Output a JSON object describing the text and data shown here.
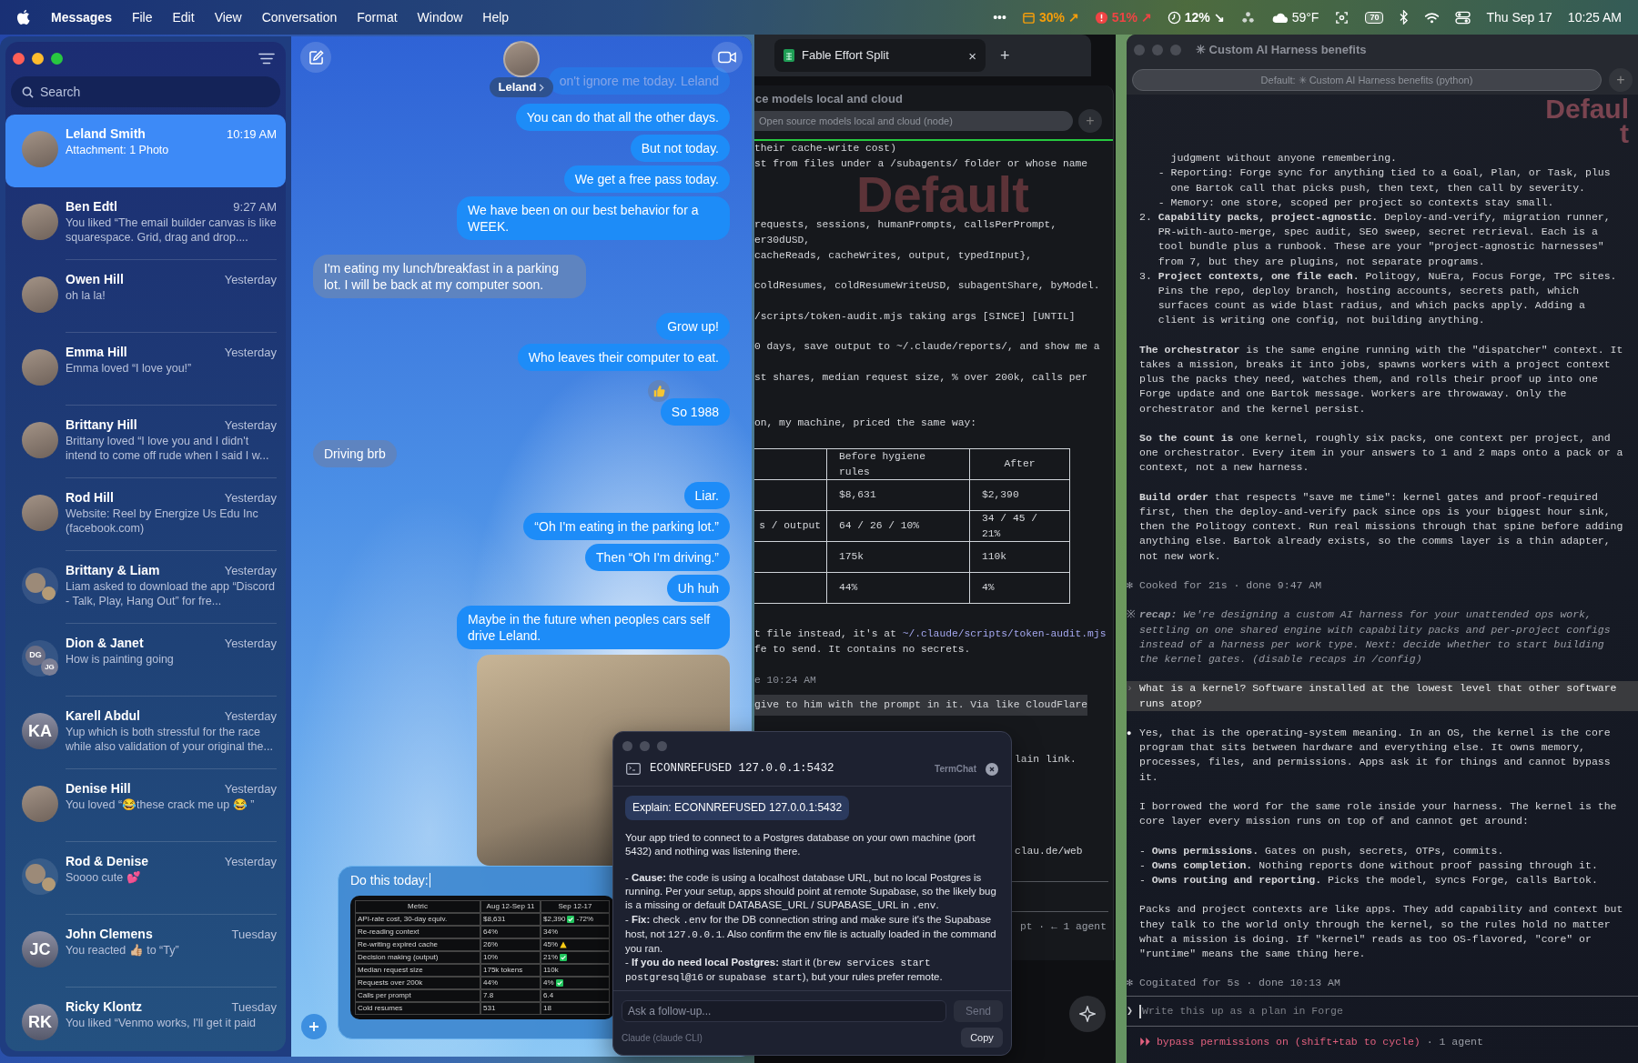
{
  "menubar": {
    "app_name": "Messages",
    "menus": [
      "File",
      "Edit",
      "View",
      "Conversation",
      "Format",
      "Window",
      "Help"
    ],
    "status_items": [
      {
        "kind": "overflow",
        "text": "•••"
      },
      {
        "kind": "calendar",
        "text": "30% ↗",
        "color": "#f59e0b"
      },
      {
        "kind": "alert",
        "text": "51% ↗",
        "color": "#ef4444"
      },
      {
        "kind": "clock",
        "text": "12% ↘",
        "color": "#ffffff"
      },
      {
        "kind": "recycle"
      },
      {
        "kind": "cloud",
        "text": "59°F"
      },
      {
        "kind": "screen"
      },
      {
        "kind": "battery",
        "text": "70"
      },
      {
        "kind": "bluetooth"
      },
      {
        "kind": "wifi"
      },
      {
        "kind": "toggles"
      },
      {
        "kind": "text",
        "text": "Thu Sep 17"
      },
      {
        "kind": "text",
        "text": "10:25 AM"
      }
    ]
  },
  "messages": {
    "search_placeholder": "Search",
    "conversations": [
      {
        "name": "Leland Smith",
        "time": "10:19 AM",
        "preview": "Attachment: 1 Photo",
        "selected": true,
        "avatar": {
          "kind": "photo"
        }
      },
      {
        "name": "Ben Edtl",
        "time": "9:27 AM",
        "preview": "You liked “The email builder canvas is like squarespace. Grid, drag and drop....",
        "selected": false,
        "avatar": {
          "kind": "photo"
        }
      },
      {
        "name": "Owen Hill",
        "time": "Yesterday",
        "preview": "oh la la!",
        "selected": false,
        "avatar": {
          "kind": "photo"
        }
      },
      {
        "name": "Emma Hill",
        "time": "Yesterday",
        "preview": "Emma loved “I love you!”",
        "selected": false,
        "avatar": {
          "kind": "photo"
        }
      },
      {
        "name": "Brittany Hill",
        "time": "Yesterday",
        "preview": "Brittany loved “I love you and I didn't intend to come off rude when I said I w...",
        "selected": false,
        "avatar": {
          "kind": "photo"
        }
      },
      {
        "name": "Rod Hill",
        "time": "Yesterday",
        "preview": "Website: Reel by Energize Us Edu Inc (facebook.com)",
        "selected": false,
        "avatar": {
          "kind": "photo"
        }
      },
      {
        "name": "Brittany & Liam",
        "time": "Yesterday",
        "preview": "Liam asked to download the app “Discord - Talk, Play, Hang Out” for fre...",
        "selected": false,
        "avatar": {
          "kind": "group_photo"
        }
      },
      {
        "name": "Dion & Janet",
        "time": "Yesterday",
        "preview": "How is painting going",
        "selected": false,
        "avatar": {
          "kind": "group_initials",
          "initials": [
            "DG",
            "JG"
          ]
        }
      },
      {
        "name": "Karell Abdul",
        "time": "Yesterday",
        "preview": "Yup which is both stressful for the race while also validation of your original the...",
        "selected": false,
        "avatar": {
          "kind": "initials",
          "initials": "KA"
        }
      },
      {
        "name": "Denise Hill",
        "time": "Yesterday",
        "preview": "You loved “😂these crack me up 😂 ”",
        "selected": false,
        "avatar": {
          "kind": "photo"
        }
      },
      {
        "name": "Rod & Denise",
        "time": "Yesterday",
        "preview": "Soooo cute 💕",
        "selected": false,
        "avatar": {
          "kind": "group_photo"
        }
      },
      {
        "name": "John Clemens",
        "time": "Tuesday",
        "preview": "You reacted 👍🏼 to “Ty”",
        "selected": false,
        "avatar": {
          "kind": "initials",
          "initials": "JC"
        }
      },
      {
        "name": "Ricky Klontz",
        "time": "Tuesday",
        "preview": "You liked “Venmo works, I'll get it paid",
        "selected": false,
        "avatar": {
          "kind": "initials",
          "initials": "RK"
        }
      }
    ]
  },
  "chat": {
    "contact": "Leland",
    "messages": [
      {
        "kind": "sent",
        "text": "on't ignore me today. Leland",
        "faded": true
      },
      {
        "kind": "sent",
        "text": "You can do that all the other days.",
        "faded": false
      },
      {
        "kind": "sent",
        "text": "But not today.",
        "faded": false
      },
      {
        "kind": "sent",
        "text": "We get a free pass today.",
        "faded": false
      },
      {
        "kind": "sent",
        "text": "We have been on our best behavior for a WEEK.",
        "faded": false
      },
      {
        "kind": "received",
        "text": "I'm eating my lunch/breakfast in a parking lot. I will be back at my computer soon.",
        "faded": false
      },
      {
        "kind": "sent",
        "text": "Grow up!",
        "faded": false
      },
      {
        "kind": "sent",
        "text": "Who leaves their computer to eat.",
        "faded": false
      },
      {
        "kind": "tapped",
        "text": "So 1988",
        "faded": false
      },
      {
        "kind": "received",
        "text": "Driving brb",
        "faded": false
      },
      {
        "kind": "sent",
        "text": "Liar.",
        "faded": false
      },
      {
        "kind": "sent",
        "text": "“Oh I'm eating in the parking lot.”",
        "faded": false
      },
      {
        "kind": "sent",
        "text": "Then “Oh I'm driving.”",
        "faded": false
      },
      {
        "kind": "sent",
        "text": "Uh huh",
        "faded": false
      },
      {
        "kind": "sent",
        "text": "Maybe in the future when peoples cars self drive Leland.",
        "faded": false
      },
      {
        "kind": "photo"
      }
    ],
    "composer": {
      "text": "Do this today:",
      "attachment": {
        "columns": [
          "Metric",
          "Aug 12-Sep 11",
          "Sep 12-17"
        ],
        "rows": [
          {
            "kind": "good",
            "cells": [
              "API-rate cost, 30-day equiv.",
              "$8,631",
              "$2,390"
            ],
            "note": "-72%"
          },
          {
            "kind": "plain",
            "cells": [
              "Re-reading context",
              "64%",
              "34%"
            ]
          },
          {
            "kind": "warning",
            "cells": [
              "Re-writing expired cache",
              "26%",
              "45%"
            ]
          },
          {
            "kind": "good",
            "cells": [
              "Decision making (output)",
              "10%",
              "21%"
            ]
          },
          {
            "kind": "plain",
            "cells": [
              "Median request size",
              "175k tokens",
              "110k"
            ]
          },
          {
            "kind": "good",
            "cells": [
              "Requests over 200k",
              "44%",
              "4%"
            ]
          },
          {
            "kind": "plain",
            "cells": [
              "Calls per prompt",
              "7.8",
              "6.4"
            ]
          },
          {
            "kind": "plain",
            "cells": [
              "Cold resumes",
              "531",
              "18"
            ]
          }
        ]
      }
    }
  },
  "middle_terminal": {
    "tab_title": "Fable Effort Split",
    "tab_close": "×",
    "new_tab": "+",
    "window_title": "ce models local and cloud",
    "session_field": "Open source models local and cloud (node)",
    "add_session": "+",
    "badge": "Default",
    "output_head": "their cache-write cost)\nst from files under a /subagents/ folder or whose name",
    "output": "requests, sessions, humanPrompts, callsPerPrompt,\ner30dUSD,\ncacheReads, cacheWrites, output, typedInput},\n\ncoldResumes, coldResumeWriteUSD, subagentShare, byModel.\n\n/scripts/token-audit.mjs taking args [SINCE] [UNTIL]\n\n0 days, save output to ~/.claude/reports/, and show me a\n\nst shares, median request size, % over 200k, calls per\n\n\non, my machine, priced the same way:",
    "table": {
      "columns": [
        "Before hygiene rules",
        "After"
      ],
      "rows": [
        {
          "before": "$8,631",
          "after": "$2,390"
        },
        {
          "column_1": "s / output",
          "before": "64 / 26 / 10%",
          "after": "34 / 45 / 21%"
        },
        {
          "before": "175k",
          "after": "110k"
        },
        {
          "before": "44%",
          "after": "4%"
        }
      ]
    },
    "link_line": {
      "text": "t file instead, it's at ",
      "link": "~/.claude/scripts/token-audit.mjs"
    },
    "after_link": "fe to send. It contains no secrets.",
    "timestamp": "e 10:24 AM",
    "highlight": "give to him with the prompt in it. Via like CloudFlare",
    "tail": "lain link.\n\n\n\n\n\nclau.de/web",
    "status": "pt · ← 1 agent"
  },
  "right_terminal": {
    "title": "✳ Custom AI Harness benefits",
    "session_field": "Default: ✳ Custom AI Harness benefits (python)",
    "add_session": "+",
    "badge": [
      "Defaul",
      "t"
    ],
    "blocks": [
      {
        "kind": "text",
        "text": "     judgment without anyone remembering.\n   - Reporting: Forge sync for anything tied to a Goal, Plan, or Task, plus\n     one Bartok call that picks push, then text, then call by severity.\n   - Memory: one store, scoped per project so contexts stay small.\n2. **Capability packs, project-agnostic.** Deploy-and-verify, migration runner,\n   PR-with-auto-merge, spec audit, SEO sweep, secret retrieval. Each is a\n   tool bundle plus a runbook. These are your \"project-agnostic harnesses\"\n   from 7, but they are plugins, not separate programs.\n3. **Project contexts, one file each.** Politogy, NuEra, Focus Forge, TPC sites.\n   Pins the repo, deploy branch, hosting accounts, secrets path, which\n   surfaces count as wide blast radius, and which packs apply. Adding a\n   client is writing one config, not building anything."
      },
      {
        "kind": "text",
        "text": "**The orchestrator** is the same engine running with the \"dispatcher\" context. It\ntakes a mission, breaks it into jobs, spawns workers with a project context\nplus the packs they need, watches them, and rolls their proof up into one\nForge update and one Bartok message. Workers are throwaway. Only the\norchestrator and the kernel persist."
      },
      {
        "kind": "text",
        "text": "**So the count is** one kernel, roughly six packs, one context per project, and\none orchestrator. Every item in your answers to 1 and 2 maps onto a pack or a\ncontext, not a new harness."
      },
      {
        "kind": "text",
        "text": "**Build order** that respects \"save me time\": kernel gates and proof-required\nfirst, then the deploy-and-verify pack since ops is your biggest hour sink,\nthen the Politogy context. Run real missions through that spine before adding\nanything else. Bartok already exists, so the comms layer is a thin adapter,\nnot new work."
      },
      {
        "kind": "meta",
        "glyph": "✻",
        "text": "Cooked for 21s · done 9:47 AM"
      },
      {
        "kind": "recap",
        "glyph": "※",
        "text": "**recap:** We're designing a custom AI harness for your unattended ops work,\nsettling on one shared engine with capability packs and per-project configs\ninstead of a harness per work type. Next: decide whether to start building\nthe kernel gates. (disable recaps in /config)"
      },
      {
        "kind": "prompt",
        "glyph": "›",
        "text": "What is a kernel? Software installed at the lowest level that other software\nruns atop?"
      },
      {
        "kind": "answer",
        "glyph": "●",
        "text": "Yes, that is the operating-system meaning. In an OS, the kernel is the core\nprogram that sits between hardware and everything else. It owns memory,\nprocesses, files, and permissions. Apps ask it for things and cannot bypass\nit."
      },
      {
        "kind": "text",
        "text": "I borrowed the word for the same role inside your harness. The kernel is the\ncore layer every mission runs on top of and cannot get around:"
      },
      {
        "kind": "text",
        "text": "- **Owns permissions.** Gates on push, secrets, OTPs, commits.\n- **Owns completion.** Nothing reports done without proof passing through it.\n- **Owns routing and reporting.** Picks the model, syncs Forge, calls Bartok."
      },
      {
        "kind": "text",
        "text": "Packs and project contexts are like apps. They add capability and context but\nthey talk to the world only through the kernel, so the rules hold no matter\nwhat a mission is doing. If \"kernel\" reads as too OS-flavored, \"core\" or\n\"runtime\" means the same thing here."
      },
      {
        "kind": "meta",
        "glyph": "✻",
        "text": "Cogitated for 5s · done 10:13 AM"
      }
    ],
    "input": {
      "prompt": "❯",
      "placeholder": "Write this up as a plan in Forge"
    },
    "status": {
      "mode": "⏵⏵ bypass permissions on (shift+tab to cycle)",
      "agents": "· 1 agent"
    }
  },
  "termchat": {
    "title": "ECONNREFUSED 127.0.0.1:5432",
    "app": "TermChat",
    "question": "Explain: ECONNREFUSED 127.0.0.1:5432",
    "paragraphs": [
      [
        {
          "kind": "plain",
          "text": "Your app tried to connect to a Postgres database on your own machine (port 5432) and nothing was listening there."
        }
      ],
      [
        {
          "kind": "plain",
          "text": "- "
        },
        {
          "kind": "bold",
          "text": "Cause:"
        },
        {
          "kind": "plain",
          "text": " the code is using a localhost database URL, but no local Postgres is running. Per your setup, apps should point at remote Supabase, so the likely bug is a missing or default DATABASE_URL / SUPABASE_URL in "
        },
        {
          "kind": "code",
          "text": ".env"
        },
        {
          "kind": "plain",
          "text": "."
        }
      ],
      [
        {
          "kind": "plain",
          "text": "- "
        },
        {
          "kind": "bold",
          "text": "Fix:"
        },
        {
          "kind": "plain",
          "text": " check "
        },
        {
          "kind": "code",
          "text": ".env"
        },
        {
          "kind": "plain",
          "text": " for the DB connection string and make sure it's the Supabase host, not "
        },
        {
          "kind": "code",
          "text": "127.0.0.1"
        },
        {
          "kind": "plain",
          "text": ". Also confirm the env file is actually loaded in the command you ran."
        }
      ],
      [
        {
          "kind": "plain",
          "text": "- "
        },
        {
          "kind": "bold",
          "text": "If you do need local Postgres:"
        },
        {
          "kind": "plain",
          "text": " start it ("
        },
        {
          "kind": "code",
          "text": "brew services start postgresql@16"
        },
        {
          "kind": "plain",
          "text": " or "
        },
        {
          "kind": "code",
          "text": "supabase start"
        },
        {
          "kind": "plain",
          "text": "), but your rules prefer remote."
        }
      ]
    ],
    "input_placeholder": "Ask a follow-up...",
    "send": "Send",
    "send_disabled": true,
    "model": "Claude (claude CLI)",
    "copy": "Copy"
  }
}
